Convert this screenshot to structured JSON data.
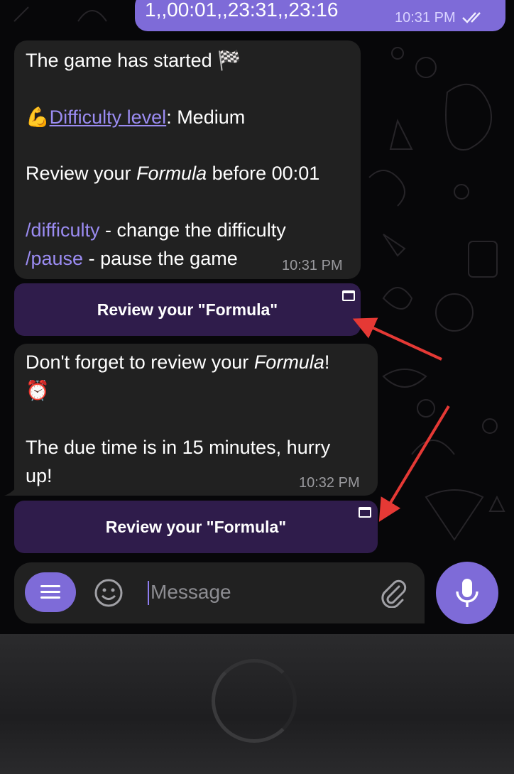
{
  "outgoing": {
    "text": "1,,00:01,,23:31,,23:16",
    "time": "10:31 PM"
  },
  "message1": {
    "line1": "The game has started 🏁",
    "difficulty_emoji": "💪",
    "difficulty_link": "Difficulty level",
    "difficulty_value": ": Medium",
    "review_prefix": "Review your ",
    "review_formula": "Formula",
    "review_suffix": " before 00:01",
    "cmd1": "/difficulty",
    "cmd1_desc": " - change the difficulty",
    "cmd2": "/pause",
    "cmd2_desc": " - pause the game",
    "time": "10:31 PM"
  },
  "button1": {
    "label": "Review your \"Formula\"",
    "icon": "webapp-window-icon"
  },
  "message2": {
    "prefix": "Don't forget to review your ",
    "formula": "Formula",
    "suffix": "!",
    "alarm": "⏰",
    "line3": "The due time is in 15 minutes, hurry",
    "line4": "up!",
    "time": "10:32 PM"
  },
  "button2": {
    "label": "Review your \"Formula\"",
    "icon": "webapp-window-icon"
  },
  "composer": {
    "placeholder": "Message",
    "menu_icon": "menu-icon",
    "emoji_icon": "smiley-icon",
    "attach_icon": "paperclip-icon",
    "mic_icon": "microphone-icon"
  },
  "colors": {
    "accent": "#7e6bd8",
    "link": "#9b8cf2",
    "bubble_in": "#212121",
    "keyboard_button": "#2f1c4b",
    "annotation_arrow": "#e53935"
  }
}
